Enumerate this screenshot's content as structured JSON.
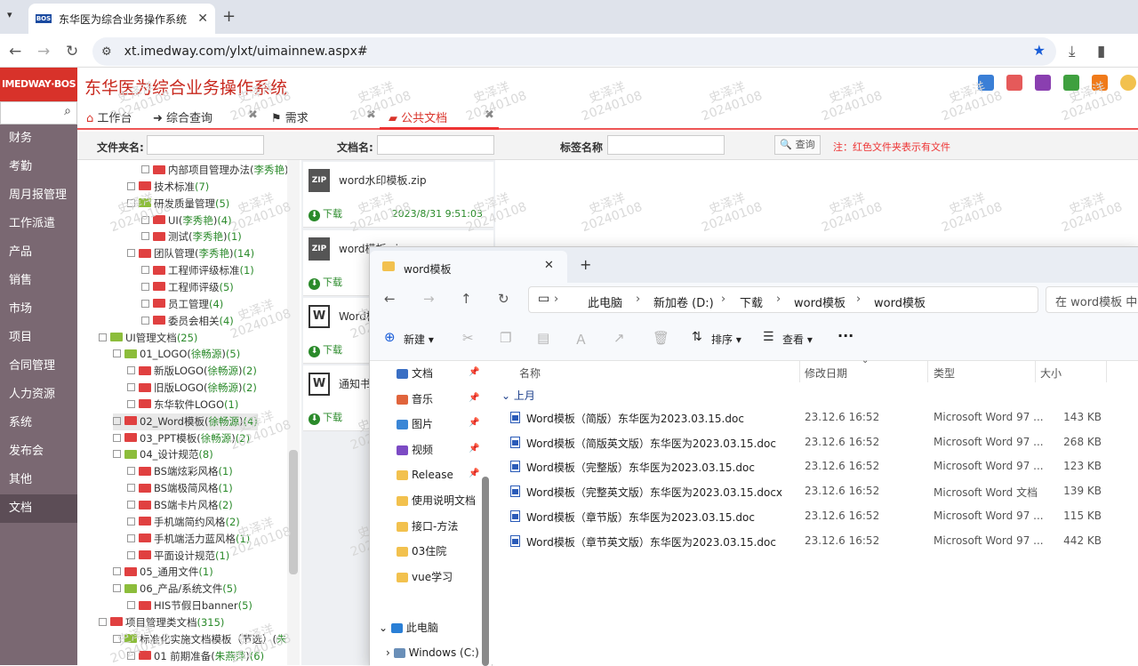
{
  "browser": {
    "tab_title": "东华医为综合业务操作系统",
    "favicon": "BOS",
    "url": "xt.imedway.com/ylxt/uimainnew.aspx#"
  },
  "app": {
    "logo": "IMEDWAY·BOS",
    "title": "东华医为综合业务操作系统"
  },
  "sidebar": [
    "财务",
    "考勤",
    "周月报管理",
    "工作派遣",
    "产品",
    "销售",
    "市场",
    "项目",
    "合同管理",
    "人力资源",
    "系统",
    "发布会",
    "其他",
    "文档"
  ],
  "tabs": [
    {
      "label": "工作台",
      "icon": "⌂"
    },
    {
      "label": "综合查询",
      "icon": "➜"
    },
    {
      "label": "需求",
      "icon": "⚑"
    },
    {
      "label": "公共文档",
      "icon": "▰"
    }
  ],
  "filters": {
    "folder_label": "文件夹名:",
    "doc_label": "文档名:",
    "tag_label": "标签名称",
    "search": "查询",
    "note": "注：红色文件夹表示有文件"
  },
  "watermark": {
    "name": "史泽洋",
    "date": "20240108"
  },
  "tree": [
    {
      "t": "内部项目管理办法",
      "o": "李秀艳",
      "c": "",
      "x": 72,
      "f": "r"
    },
    {
      "t": "技术标准",
      "o": "",
      "c": "(7)",
      "x": 56,
      "f": "r"
    },
    {
      "t": "研发质量管理",
      "o": "",
      "c": "(5)",
      "x": 56,
      "f": "g"
    },
    {
      "t": "UI",
      "o": "李秀艳",
      "c": "(4)",
      "x": 72,
      "f": "r"
    },
    {
      "t": "测试",
      "o": "李秀艳",
      "c": "(1)",
      "x": 72,
      "f": "r"
    },
    {
      "t": "团队管理",
      "o": "李秀艳",
      "c": "(14)",
      "x": 56,
      "f": "r"
    },
    {
      "t": "工程师评级标准",
      "o": "",
      "c": "(1)",
      "x": 72,
      "f": "r"
    },
    {
      "t": "工程师评级",
      "o": "",
      "c": "(5)",
      "x": 72,
      "f": "r"
    },
    {
      "t": "员工管理",
      "o": "",
      "c": "(4)",
      "x": 72,
      "f": "r"
    },
    {
      "t": "委员会相关",
      "o": "",
      "c": "(4)",
      "x": 72,
      "f": "r"
    },
    {
      "t": "UI管理文档",
      "o": "",
      "c": "(25)",
      "x": 24,
      "f": "g"
    },
    {
      "t": "01_LOGO",
      "o": "徐畅源",
      "c": "(5)",
      "x": 40,
      "f": "g"
    },
    {
      "t": "新版LOGO",
      "o": "徐畅源",
      "c": "(2)",
      "x": 56,
      "f": "r"
    },
    {
      "t": "旧版LOGO",
      "o": "徐畅源",
      "c": "(2)",
      "x": 56,
      "f": "r"
    },
    {
      "t": "东华软件LOGO",
      "o": "",
      "c": "(1)",
      "x": 56,
      "f": "r"
    },
    {
      "t": "02_Word模板",
      "o": "徐畅源",
      "c": "(4)",
      "x": 40,
      "f": "r",
      "sel": true
    },
    {
      "t": "03_PPT模板",
      "o": "徐畅源",
      "c": "(2)",
      "x": 40,
      "f": "r"
    },
    {
      "t": "04_设计规范",
      "o": "",
      "c": "(8)",
      "x": 40,
      "f": "g"
    },
    {
      "t": "BS端炫彩风格",
      "o": "",
      "c": "(1)",
      "x": 56,
      "f": "r"
    },
    {
      "t": "BS端极简风格",
      "o": "",
      "c": "(1)",
      "x": 56,
      "f": "r"
    },
    {
      "t": "BS端卡片风格",
      "o": "",
      "c": "(2)",
      "x": 56,
      "f": "r"
    },
    {
      "t": "手机端简约风格",
      "o": "",
      "c": "(2)",
      "x": 56,
      "f": "r"
    },
    {
      "t": "手机端活力蓝风格",
      "o": "",
      "c": "(1)",
      "x": 56,
      "f": "r"
    },
    {
      "t": "平面设计规范",
      "o": "",
      "c": "(1)",
      "x": 56,
      "f": "r"
    },
    {
      "t": "05_通用文件",
      "o": "",
      "c": "(1)",
      "x": 40,
      "f": "r"
    },
    {
      "t": "06_产品/系统文件",
      "o": "",
      "c": "(5)",
      "x": 40,
      "f": "g"
    },
    {
      "t": "HIS节假日banner",
      "o": "",
      "c": "(5)",
      "x": 56,
      "f": "r"
    },
    {
      "t": "项目管理类文档",
      "o": "",
      "c": "(315)",
      "x": 24,
      "f": "r"
    },
    {
      "t": "标准化实施文档模板（节选）",
      "o": "朱燕萍",
      "c": "",
      "x": 40,
      "f": "g"
    },
    {
      "t": "01 前期准备",
      "o": "朱燕萍",
      "c": "(6)",
      "x": 56,
      "f": "r"
    }
  ],
  "files": [
    {
      "name": "word水印模板.zip",
      "icon": "ZIP",
      "dl": "下载",
      "date": "2023/8/31 9:51:03"
    },
    {
      "name": "word模板.zip",
      "icon": "ZIP",
      "dl": "下载",
      "date": ""
    },
    {
      "name": "Word模",
      "icon": "W",
      "dl": "下载",
      "date": ""
    },
    {
      "name": "通知书",
      "icon": "W",
      "dl": "下载",
      "date": ""
    }
  ],
  "explorer": {
    "tab": "word模板",
    "crumbs": [
      "此电脑",
      "新加卷 (D:)",
      "下载",
      "word模板",
      "word模板"
    ],
    "search": "在 word模板 中搜",
    "cmds": [
      "新建",
      "排序",
      "查看"
    ],
    "nav": [
      {
        "l": "文档",
        "c": "#3a6fc4",
        "pin": true
      },
      {
        "l": "音乐",
        "c": "#e0643c",
        "pin": true
      },
      {
        "l": "图片",
        "c": "#3a86d6",
        "pin": true
      },
      {
        "l": "视频",
        "c": "#7c4bc4",
        "pin": true
      },
      {
        "l": "Release",
        "c": "#f2c14e",
        "pin": true
      },
      {
        "l": "使用说明文档",
        "c": "#f2c14e"
      },
      {
        "l": "接口-方法",
        "c": "#f2c14e"
      },
      {
        "l": "03住院",
        "c": "#f2c14e"
      },
      {
        "l": "vue学习",
        "c": "#f2c14e"
      }
    ],
    "this_pc": "此电脑",
    "drive": "Windows (C:)",
    "cols": [
      "名称",
      "修改日期",
      "类型",
      "大小"
    ],
    "group": "上月",
    "rows": [
      {
        "n": "Word模板（简版）东华医为2023.03.15.doc",
        "d": "23.12.6 16:52",
        "t": "Microsoft Word 97 ...",
        "s": "143 KB"
      },
      {
        "n": "Word模板（简版英文版）东华医为2023.03.15.doc",
        "d": "23.12.6 16:52",
        "t": "Microsoft Word 97 ...",
        "s": "268 KB"
      },
      {
        "n": "Word模板（完整版）东华医为2023.03.15.doc",
        "d": "23.12.6 16:52",
        "t": "Microsoft Word 97 ...",
        "s": "123 KB"
      },
      {
        "n": "Word模板（完整英文版）东华医为2023.03.15.docx",
        "d": "23.12.6 16:52",
        "t": "Microsoft Word 文档",
        "s": "139 KB"
      },
      {
        "n": "Word模板（章节版）东华医为2023.03.15.doc",
        "d": "23.12.6 16:52",
        "t": "Microsoft Word 97 ...",
        "s": "115 KB"
      },
      {
        "n": "Word模板（章节英文版）东华医为2023.03.15.doc",
        "d": "23.12.6 16:52",
        "t": "Microsoft Word 97 ...",
        "s": "442 KB"
      }
    ]
  }
}
